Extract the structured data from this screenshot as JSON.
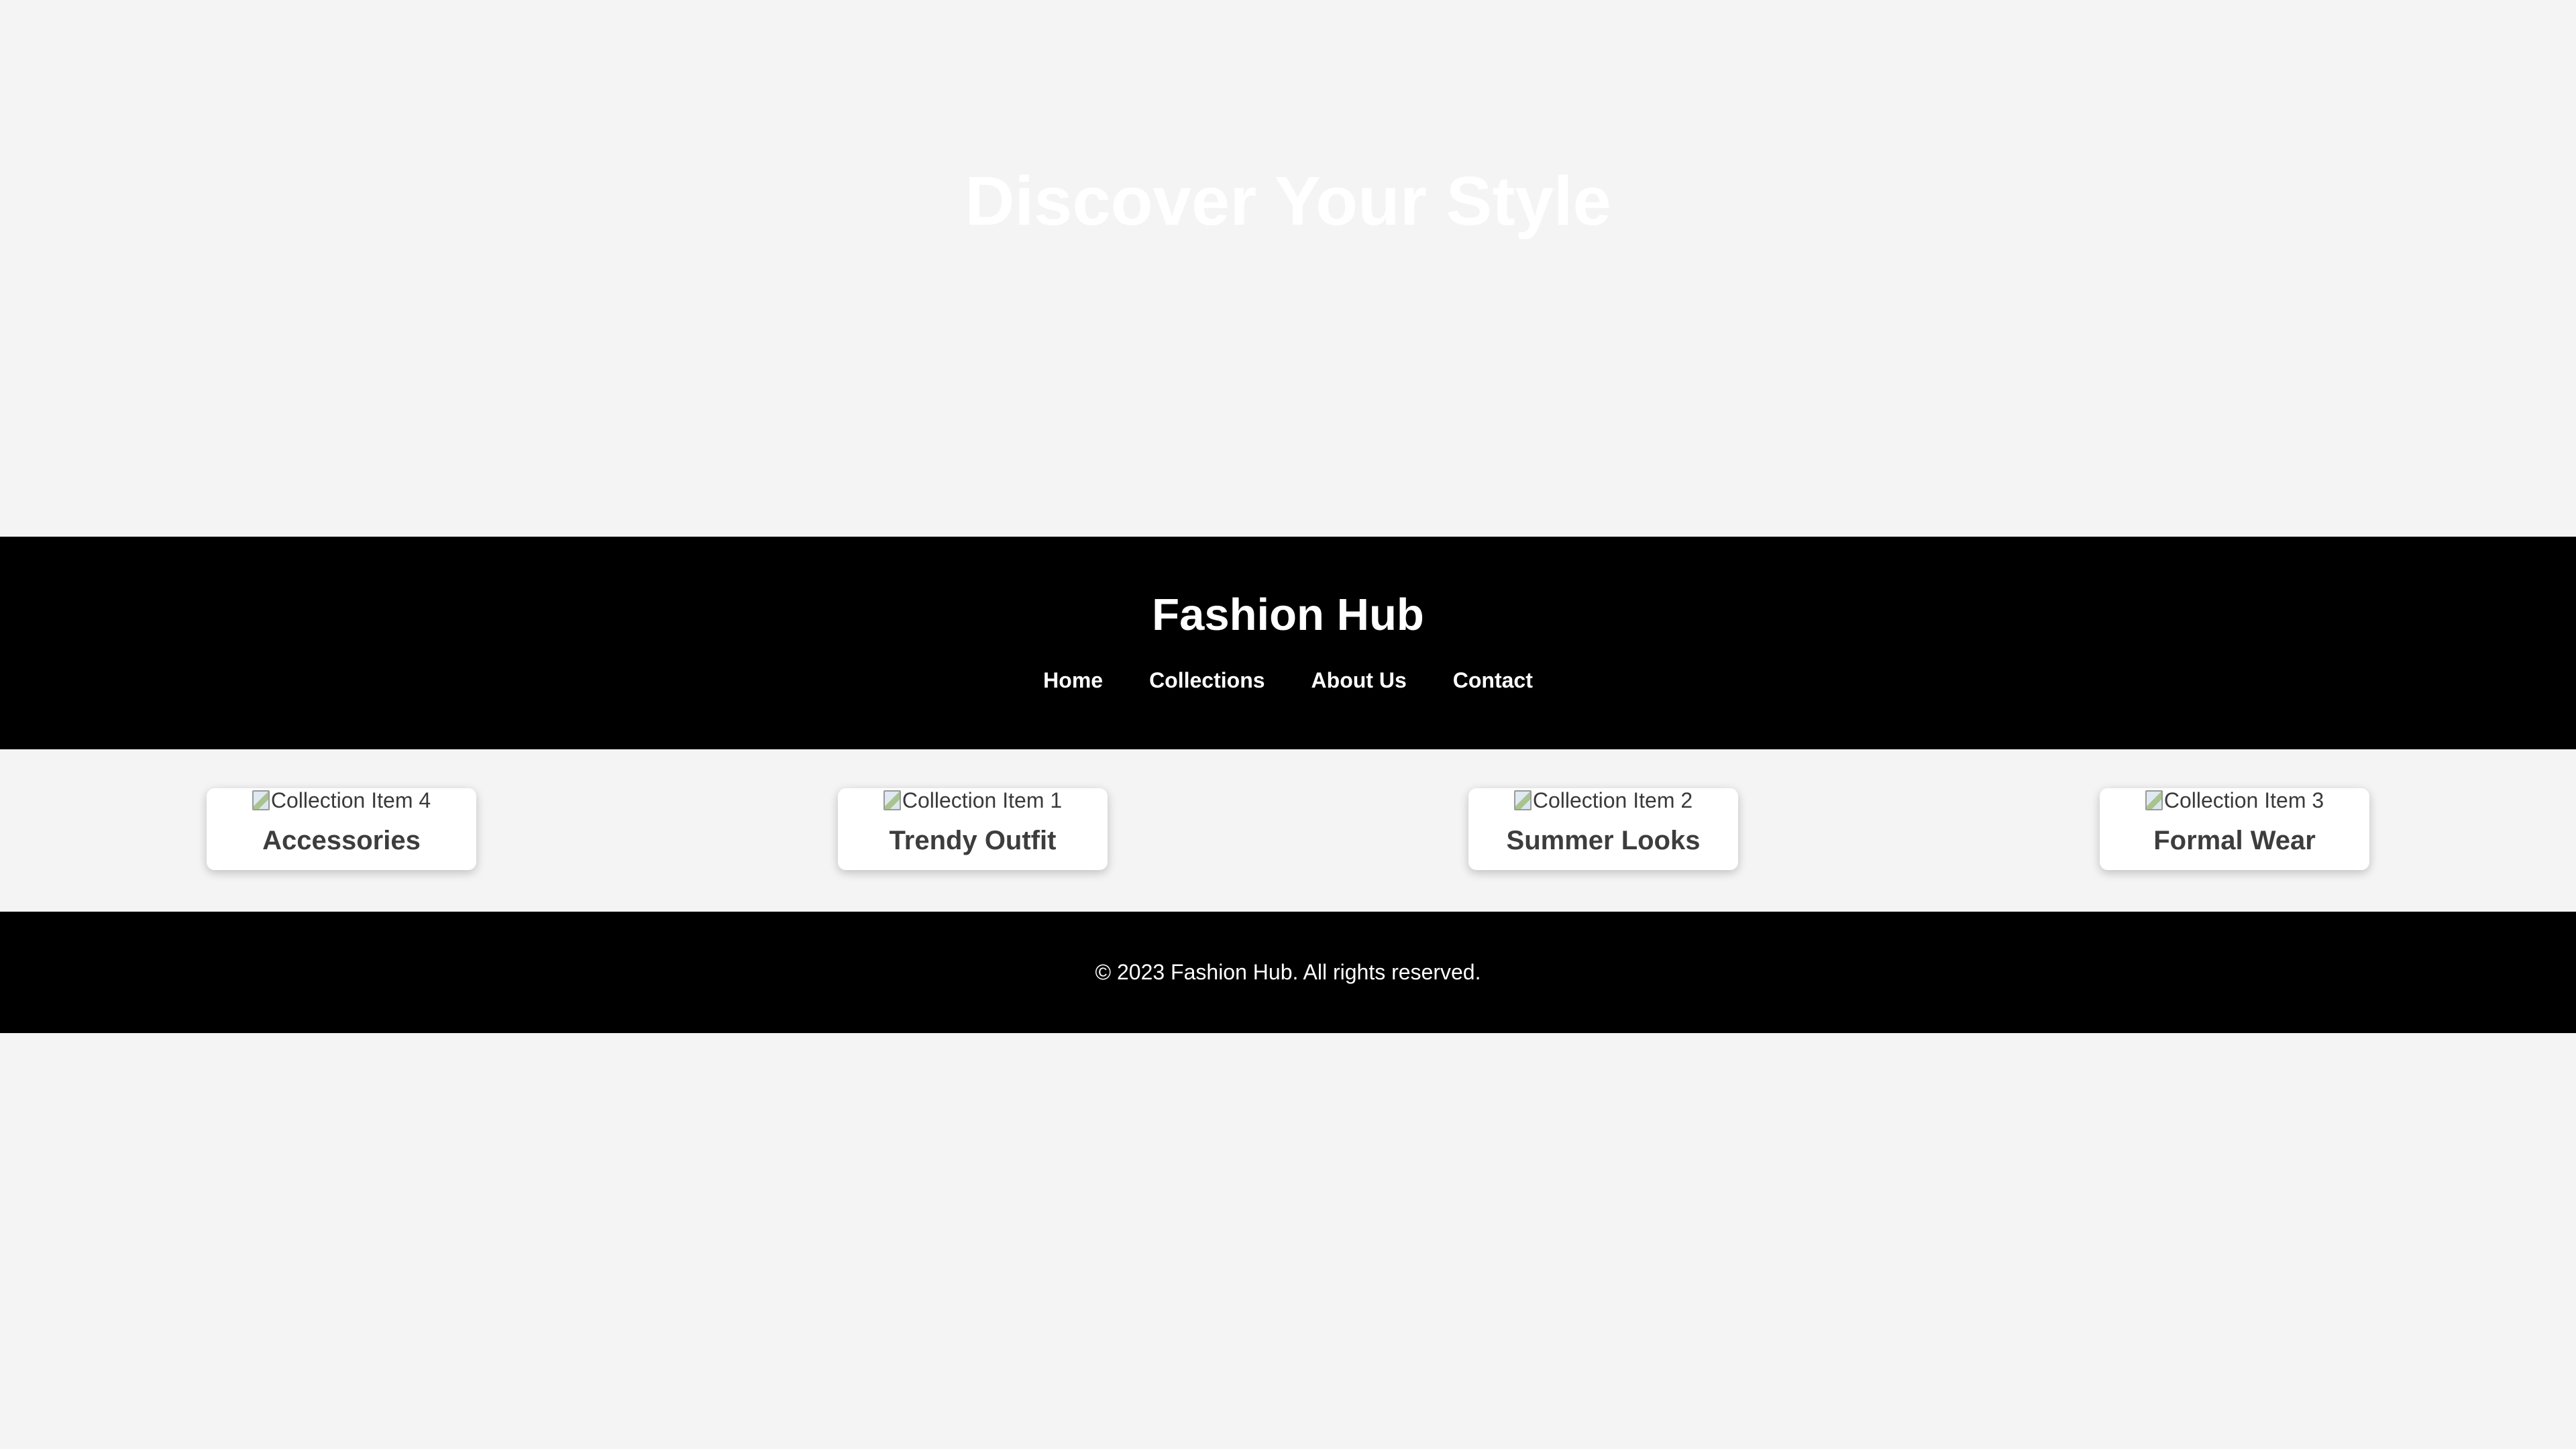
{
  "hero": {
    "title": "Discover Your Style"
  },
  "header": {
    "brand": "Fashion Hub",
    "nav": [
      {
        "label": "Home"
      },
      {
        "label": "Collections"
      },
      {
        "label": "About Us"
      },
      {
        "label": "Contact"
      }
    ]
  },
  "collections": {
    "items": [
      {
        "image_alt": "Collection Item 4",
        "title": "Accessories"
      },
      {
        "image_alt": "Collection Item 1",
        "title": "Trendy Outfit"
      },
      {
        "image_alt": "Collection Item 2",
        "title": "Summer Looks"
      },
      {
        "image_alt": "Collection Item 3",
        "title": "Formal Wear"
      }
    ]
  },
  "footer": {
    "copyright": "© 2023 Fashion Hub. All rights reserved."
  },
  "colors": {
    "page_background": "#f4f4f4",
    "header_background": "#000000",
    "footer_background": "#000000",
    "card_background": "#ffffff",
    "hero_text": "#ffffff",
    "card_text": "#3d3d3d"
  }
}
